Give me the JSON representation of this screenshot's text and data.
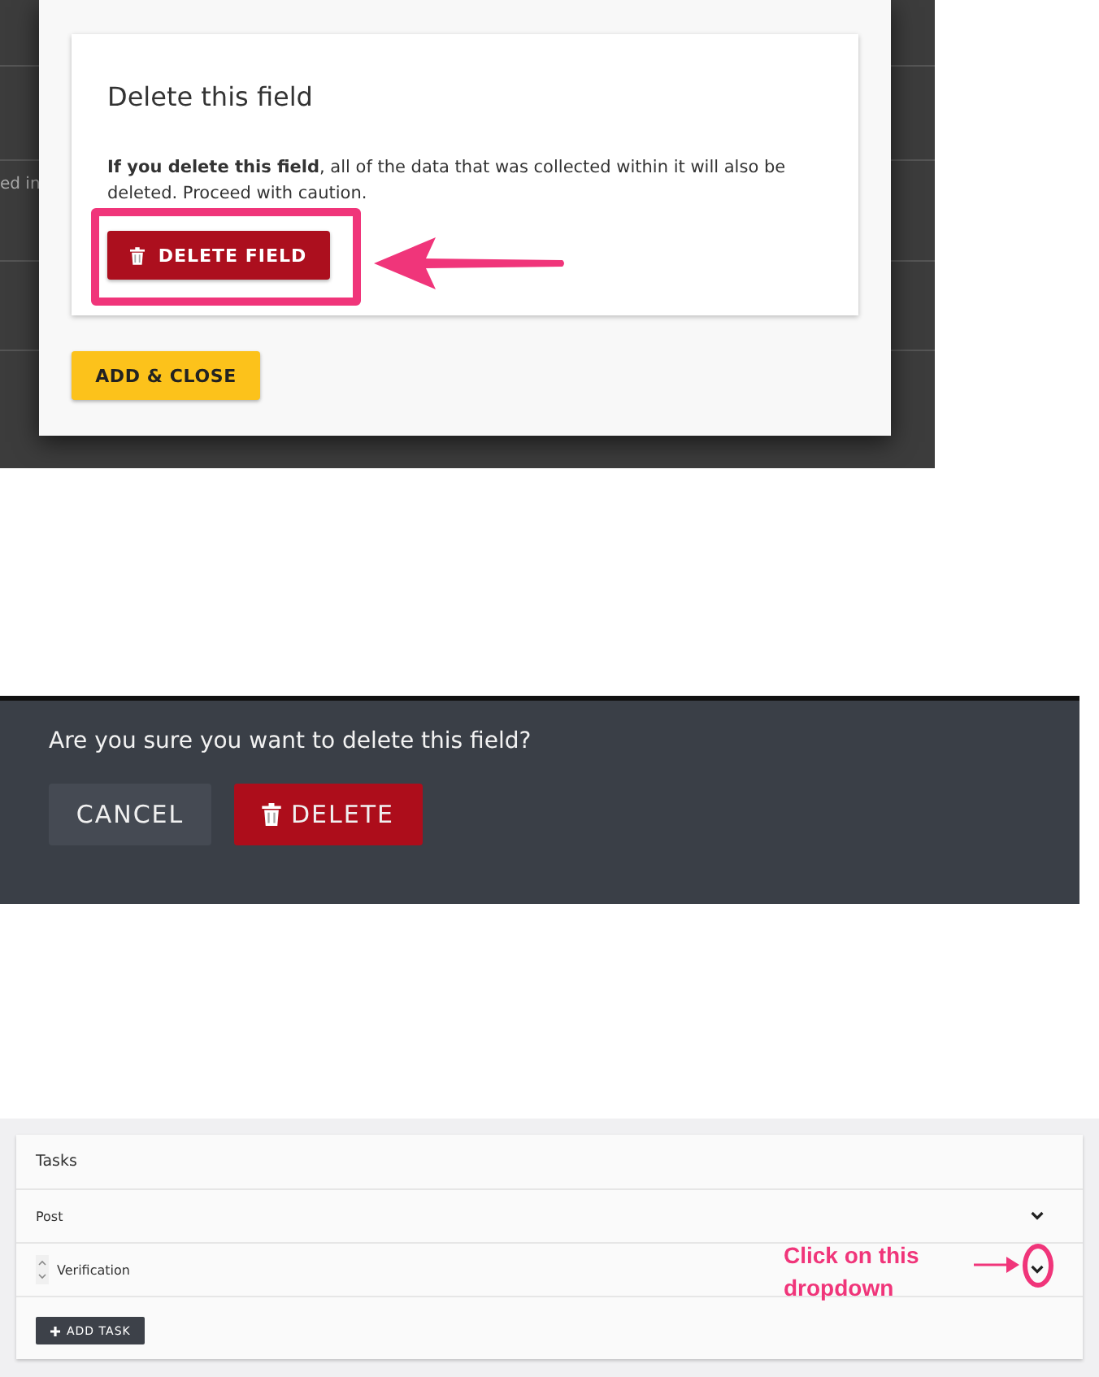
{
  "dialog": {
    "background_text": "ed in",
    "title": "Delete this field",
    "body": "**If you delete this field**, all of the data that was collected within it will also be deleted. Proceed with caution.",
    "delete_button": "DELETE FIELD",
    "add_close_button": "ADD & CLOSE"
  },
  "confirm": {
    "question": "Are you sure you want to delete this field?",
    "buttons": [
      {
        "label": "CANCEL",
        "kind": "secondary"
      },
      {
        "label": "DELETE",
        "kind": "danger"
      }
    ]
  },
  "tasks": {
    "title": "Tasks",
    "rows": [
      {
        "label": "Post",
        "reorder": false
      },
      {
        "label": "Verification",
        "reorder": true
      }
    ],
    "add_button": "ADD TASK",
    "annotation": "Click on this dropdown"
  }
}
